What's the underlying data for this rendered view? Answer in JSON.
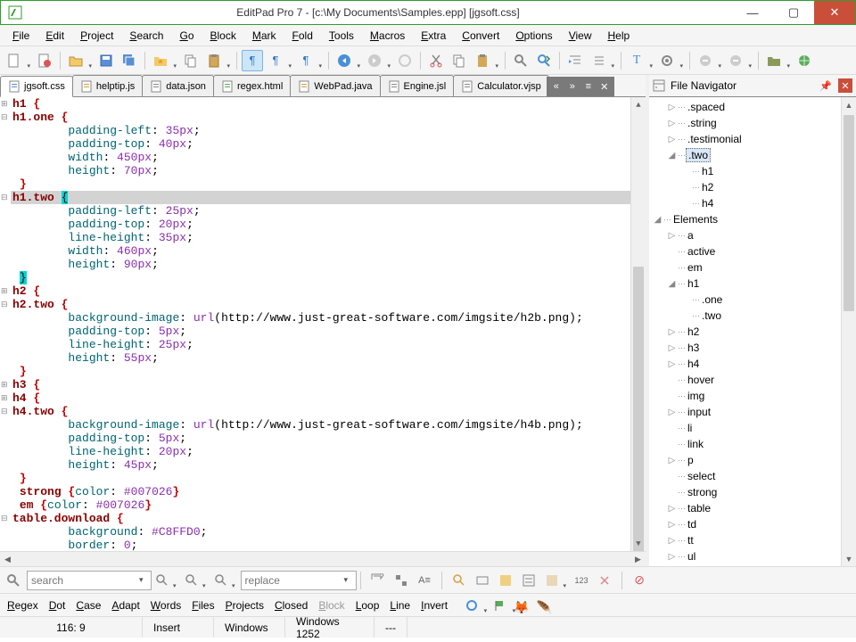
{
  "window": {
    "title": "EditPad Pro 7 - [c:\\My Documents\\Samples.epp] [jgsoft.css]"
  },
  "menu": [
    "File",
    "Edit",
    "Project",
    "Search",
    "Go",
    "Block",
    "Mark",
    "Fold",
    "Tools",
    "Macros",
    "Extra",
    "Convert",
    "Options",
    "View",
    "Help"
  ],
  "tabs": [
    {
      "label": "jgsoft.css",
      "icon": "css",
      "active": true
    },
    {
      "label": "helptip.js",
      "icon": "js",
      "active": false
    },
    {
      "label": "data.json",
      "icon": "json",
      "active": false
    },
    {
      "label": "regex.html",
      "icon": "html",
      "active": false
    },
    {
      "label": "WebPad.java",
      "icon": "java",
      "active": false
    },
    {
      "label": "Engine.jsl",
      "icon": "jsl",
      "active": false
    },
    {
      "label": "Calculator.vjsp",
      "icon": "vjsp",
      "active": false
    }
  ],
  "code_lines": [
    {
      "fold": "plus",
      "segs": [
        {
          "t": "h1 ",
          "c": "k-sel"
        },
        {
          "t": "{",
          "c": "k-brace"
        }
      ]
    },
    {
      "fold": "minus",
      "segs": [
        {
          "t": "h1.one ",
          "c": "k-sel"
        },
        {
          "t": "{",
          "c": "k-brace"
        }
      ]
    },
    {
      "segs": [
        {
          "t": "        "
        },
        {
          "t": "padding-left",
          "c": "k-prop"
        },
        {
          "t": ": "
        },
        {
          "t": "35px",
          "c": "k-val"
        },
        {
          "t": ";"
        }
      ]
    },
    {
      "segs": [
        {
          "t": "        "
        },
        {
          "t": "padding-top",
          "c": "k-prop"
        },
        {
          "t": ": "
        },
        {
          "t": "40px",
          "c": "k-val"
        },
        {
          "t": ";"
        }
      ]
    },
    {
      "segs": [
        {
          "t": "        "
        },
        {
          "t": "width",
          "c": "k-prop"
        },
        {
          "t": ": "
        },
        {
          "t": "450px",
          "c": "k-val"
        },
        {
          "t": ";"
        }
      ]
    },
    {
      "segs": [
        {
          "t": "        "
        },
        {
          "t": "height",
          "c": "k-prop"
        },
        {
          "t": ": "
        },
        {
          "t": "70px",
          "c": "k-val"
        },
        {
          "t": ";"
        }
      ]
    },
    {
      "segs": [
        {
          "t": " "
        },
        {
          "t": "}",
          "c": "k-brace"
        }
      ]
    },
    {
      "fold": "minus",
      "selected": true,
      "segs": [
        {
          "t": "h1.two ",
          "c": "k-sel"
        },
        {
          "t": "{",
          "c": "caret-br"
        }
      ]
    },
    {
      "segs": [
        {
          "t": "        "
        },
        {
          "t": "padding-left",
          "c": "k-prop"
        },
        {
          "t": ": "
        },
        {
          "t": "25px",
          "c": "k-val"
        },
        {
          "t": ";"
        }
      ]
    },
    {
      "segs": [
        {
          "t": "        "
        },
        {
          "t": "padding-top",
          "c": "k-prop"
        },
        {
          "t": ": "
        },
        {
          "t": "20px",
          "c": "k-val"
        },
        {
          "t": ";"
        }
      ]
    },
    {
      "segs": [
        {
          "t": "        "
        },
        {
          "t": "line-height",
          "c": "k-prop"
        },
        {
          "t": ": "
        },
        {
          "t": "35px",
          "c": "k-val"
        },
        {
          "t": ";"
        }
      ]
    },
    {
      "segs": [
        {
          "t": "        "
        },
        {
          "t": "width",
          "c": "k-prop"
        },
        {
          "t": ": "
        },
        {
          "t": "460px",
          "c": "k-val"
        },
        {
          "t": ";"
        }
      ]
    },
    {
      "segs": [
        {
          "t": "        "
        },
        {
          "t": "height",
          "c": "k-prop"
        },
        {
          "t": ": "
        },
        {
          "t": "90px",
          "c": "k-val"
        },
        {
          "t": ";"
        }
      ]
    },
    {
      "segs": [
        {
          "t": " "
        },
        {
          "t": "}",
          "c": "caret-br"
        }
      ]
    },
    {
      "fold": "plus",
      "segs": [
        {
          "t": "h2 ",
          "c": "k-sel"
        },
        {
          "t": "{",
          "c": "k-brace"
        }
      ]
    },
    {
      "fold": "minus",
      "segs": [
        {
          "t": "h2.two ",
          "c": "k-sel"
        },
        {
          "t": "{",
          "c": "k-brace"
        }
      ]
    },
    {
      "segs": [
        {
          "t": "        "
        },
        {
          "t": "background-image",
          "c": "k-prop"
        },
        {
          "t": ": "
        },
        {
          "t": "url",
          "c": "k-kw"
        },
        {
          "t": "(http://www.just-great-software.com/imgsite/h2b.png)",
          "c": "k-url"
        },
        {
          "t": ";"
        }
      ]
    },
    {
      "segs": [
        {
          "t": "        "
        },
        {
          "t": "padding-top",
          "c": "k-prop"
        },
        {
          "t": ": "
        },
        {
          "t": "5px",
          "c": "k-val"
        },
        {
          "t": ";"
        }
      ]
    },
    {
      "segs": [
        {
          "t": "        "
        },
        {
          "t": "line-height",
          "c": "k-prop"
        },
        {
          "t": ": "
        },
        {
          "t": "25px",
          "c": "k-val"
        },
        {
          "t": ";"
        }
      ]
    },
    {
      "segs": [
        {
          "t": "        "
        },
        {
          "t": "height",
          "c": "k-prop"
        },
        {
          "t": ": "
        },
        {
          "t": "55px",
          "c": "k-val"
        },
        {
          "t": ";"
        }
      ]
    },
    {
      "segs": [
        {
          "t": " "
        },
        {
          "t": "}",
          "c": "k-brace"
        }
      ]
    },
    {
      "fold": "plus",
      "segs": [
        {
          "t": "h3 ",
          "c": "k-sel"
        },
        {
          "t": "{",
          "c": "k-brace"
        }
      ]
    },
    {
      "fold": "plus",
      "segs": [
        {
          "t": "h4 ",
          "c": "k-sel"
        },
        {
          "t": "{",
          "c": "k-brace"
        }
      ]
    },
    {
      "fold": "minus",
      "segs": [
        {
          "t": "h4.two ",
          "c": "k-sel"
        },
        {
          "t": "{",
          "c": "k-brace"
        }
      ]
    },
    {
      "segs": [
        {
          "t": "        "
        },
        {
          "t": "background-image",
          "c": "k-prop"
        },
        {
          "t": ": "
        },
        {
          "t": "url",
          "c": "k-kw"
        },
        {
          "t": "(http://www.just-great-software.com/imgsite/h4b.png)",
          "c": "k-url"
        },
        {
          "t": ";"
        }
      ]
    },
    {
      "segs": [
        {
          "t": "        "
        },
        {
          "t": "padding-top",
          "c": "k-prop"
        },
        {
          "t": ": "
        },
        {
          "t": "5px",
          "c": "k-val"
        },
        {
          "t": ";"
        }
      ]
    },
    {
      "segs": [
        {
          "t": "        "
        },
        {
          "t": "line-height",
          "c": "k-prop"
        },
        {
          "t": ": "
        },
        {
          "t": "20px",
          "c": "k-val"
        },
        {
          "t": ";"
        }
      ]
    },
    {
      "segs": [
        {
          "t": "        "
        },
        {
          "t": "height",
          "c": "k-prop"
        },
        {
          "t": ": "
        },
        {
          "t": "45px",
          "c": "k-val"
        },
        {
          "t": ";"
        }
      ]
    },
    {
      "segs": [
        {
          "t": " "
        },
        {
          "t": "}",
          "c": "k-brace"
        }
      ]
    },
    {
      "segs": [
        {
          "t": " "
        },
        {
          "t": "strong ",
          "c": "k-sel"
        },
        {
          "t": "{",
          "c": "k-brace"
        },
        {
          "t": "color",
          "c": "k-prop"
        },
        {
          "t": ": "
        },
        {
          "t": "#007026",
          "c": "k-val"
        },
        {
          "t": "}",
          "c": "k-brace"
        }
      ]
    },
    {
      "segs": [
        {
          "t": " "
        },
        {
          "t": "em ",
          "c": "k-sel"
        },
        {
          "t": "{",
          "c": "k-brace"
        },
        {
          "t": "color",
          "c": "k-prop"
        },
        {
          "t": ": "
        },
        {
          "t": "#007026",
          "c": "k-val"
        },
        {
          "t": "}",
          "c": "k-brace"
        }
      ]
    },
    {
      "fold": "minus",
      "segs": [
        {
          "t": "table.download ",
          "c": "k-sel"
        },
        {
          "t": "{",
          "c": "k-brace"
        }
      ]
    },
    {
      "segs": [
        {
          "t": "        "
        },
        {
          "t": "background",
          "c": "k-prop"
        },
        {
          "t": ": "
        },
        {
          "t": "#C8FFD0",
          "c": "k-val"
        },
        {
          "t": ";"
        }
      ]
    },
    {
      "segs": [
        {
          "t": "        "
        },
        {
          "t": "border",
          "c": "k-prop"
        },
        {
          "t": ": "
        },
        {
          "t": "0",
          "c": "k-val"
        },
        {
          "t": ";"
        }
      ]
    }
  ],
  "navigator": {
    "title": "File Navigator",
    "tree": [
      {
        "depth": 1,
        "exp": "right",
        "label": ".spaced"
      },
      {
        "depth": 1,
        "exp": "right",
        "label": ".string"
      },
      {
        "depth": 1,
        "exp": "right",
        "label": ".testimonial"
      },
      {
        "depth": 1,
        "exp": "down",
        "label": ".two",
        "selected": true
      },
      {
        "depth": 2,
        "exp": "",
        "label": "h1"
      },
      {
        "depth": 2,
        "exp": "",
        "label": "h2"
      },
      {
        "depth": 2,
        "exp": "",
        "label": "h4"
      },
      {
        "depth": 0,
        "exp": "down",
        "label": "Elements"
      },
      {
        "depth": 1,
        "exp": "right",
        "label": "a"
      },
      {
        "depth": 1,
        "exp": "",
        "label": "active"
      },
      {
        "depth": 1,
        "exp": "",
        "label": "em"
      },
      {
        "depth": 1,
        "exp": "down",
        "label": "h1"
      },
      {
        "depth": 2,
        "exp": "",
        "label": ".one"
      },
      {
        "depth": 2,
        "exp": "",
        "label": ".two"
      },
      {
        "depth": 1,
        "exp": "right",
        "label": "h2"
      },
      {
        "depth": 1,
        "exp": "right",
        "label": "h3"
      },
      {
        "depth": 1,
        "exp": "right",
        "label": "h4"
      },
      {
        "depth": 1,
        "exp": "",
        "label": "hover"
      },
      {
        "depth": 1,
        "exp": "",
        "label": "img"
      },
      {
        "depth": 1,
        "exp": "right",
        "label": "input"
      },
      {
        "depth": 1,
        "exp": "",
        "label": "li"
      },
      {
        "depth": 1,
        "exp": "",
        "label": "link"
      },
      {
        "depth": 1,
        "exp": "right",
        "label": "p"
      },
      {
        "depth": 1,
        "exp": "",
        "label": "select"
      },
      {
        "depth": 1,
        "exp": "",
        "label": "strong"
      },
      {
        "depth": 1,
        "exp": "right",
        "label": "table"
      },
      {
        "depth": 1,
        "exp": "right",
        "label": "td"
      },
      {
        "depth": 1,
        "exp": "right",
        "label": "tt"
      },
      {
        "depth": 1,
        "exp": "right",
        "label": "ul"
      }
    ]
  },
  "search": {
    "placeholder": "search",
    "replace_placeholder": "replace"
  },
  "options": [
    "Regex",
    "Dot",
    "Case",
    "Adapt",
    "Words",
    "Files",
    "Projects",
    "Closed",
    "Block",
    "Loop",
    "Line",
    "Invert"
  ],
  "status": {
    "pos": "116: 9",
    "mode": "Insert",
    "os": "Windows",
    "enc": "Windows 1252",
    "extra": "---"
  }
}
